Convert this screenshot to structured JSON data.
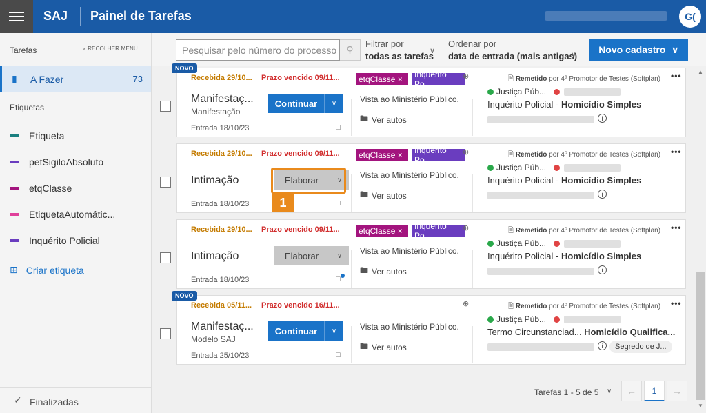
{
  "header": {
    "app_name": "SAJ",
    "title": "Painel de Tarefas",
    "avatar_initials": "G("
  },
  "sidebar": {
    "title": "Tarefas",
    "collapse_label": "« RECOLHER MENU",
    "active_item": {
      "label": "A Fazer",
      "count": "73"
    },
    "labels_title": "Etiquetas",
    "tags": [
      {
        "label": "Etiqueta",
        "color": "#1a7f7f"
      },
      {
        "label": "petSigiloAbsoluto",
        "color": "#6a3dbf"
      },
      {
        "label": "etqClasse",
        "color": "#a3147e"
      },
      {
        "label": "EtiquetaAutomátic...",
        "color": "#e0409a"
      },
      {
        "label": "Inquérito Policial",
        "color": "#6a3dbf"
      }
    ],
    "create_label": "Criar etiqueta",
    "finished_label": "Finalizadas"
  },
  "toolbar": {
    "search_placeholder": "Pesquisar pelo número do processo",
    "filter_label": "Filtrar por",
    "filter_value": "todas as tarefas",
    "order_label": "Ordenar por",
    "order_value": "data de entrada (mais antigas)",
    "new_button": "Novo cadastro"
  },
  "cards": [
    {
      "novo": "NOVO",
      "received": "Recebida 29/10...",
      "deadline": "Prazo vencido 09/11...",
      "title": "Manifestaç...",
      "subtitle": "Manifestação",
      "entry": "Entrada 18/10/23",
      "action": "Continuar",
      "chip1": "etqClasse ×",
      "chip2": "Inquérito Po...",
      "desc": "Vista ao Ministério Público.",
      "autos": "Ver autos",
      "rem_b": "Remetido",
      "rem_rest": " por 4º Promotor de Testes (Softplan)",
      "justica": "Justiça Púb...",
      "line1": "Inquérito Policial - ",
      "line1b": "Homicídio Simples"
    },
    {
      "received": "Recebida 29/10...",
      "deadline": "Prazo vencido 09/11...",
      "title": "Intimação",
      "entry": "Entrada 18/10/23",
      "action": "Elaborar",
      "chip1": "etqClasse ×",
      "chip2": "Inquérito Po...",
      "desc": "Vista ao Ministério Público.",
      "autos": "Ver autos",
      "rem_b": "Remetido",
      "rem_rest": " por 4º Promotor de Testes (Softplan)",
      "justica": "Justiça Púb...",
      "line1": "Inquérito Policial - ",
      "line1b": "Homicídio Simples",
      "highlight": "1"
    },
    {
      "received": "Recebida 29/10...",
      "deadline": "Prazo vencido 09/11...",
      "title": "Intimação",
      "entry": "Entrada 18/10/23",
      "action": "Elaborar",
      "chip1": "etqClasse ×",
      "chip2": "Inquérito Po...",
      "desc": "Vista ao Ministério Público.",
      "autos": "Ver autos",
      "rem_b": "Remetido",
      "rem_rest": " por 4º Promotor de Testes (Softplan)",
      "justica": "Justiça Púb...",
      "line1": "Inquérito Policial - ",
      "line1b": "Homicídio Simples"
    },
    {
      "novo": "NOVO",
      "received": "Recebida 05/11...",
      "deadline": "Prazo vencido 16/11...",
      "title": "Manifestaç...",
      "subtitle": "Modelo SAJ",
      "entry": "Entrada 25/10/23",
      "action": "Continuar",
      "desc": "Vista ao Ministério Público.",
      "autos": "Ver autos",
      "rem_b": "Remetido",
      "rem_rest": " por 4º Promotor de Testes (Softplan)",
      "justica": "Justiça Púb...",
      "line1": "Termo Circunstanciad...  ",
      "line1b": "Homicídio Qualifica...",
      "segredo": "Segredo de J..."
    }
  ],
  "pager": {
    "summary": "Tarefas 1 - 5 de 5",
    "current": "1"
  }
}
